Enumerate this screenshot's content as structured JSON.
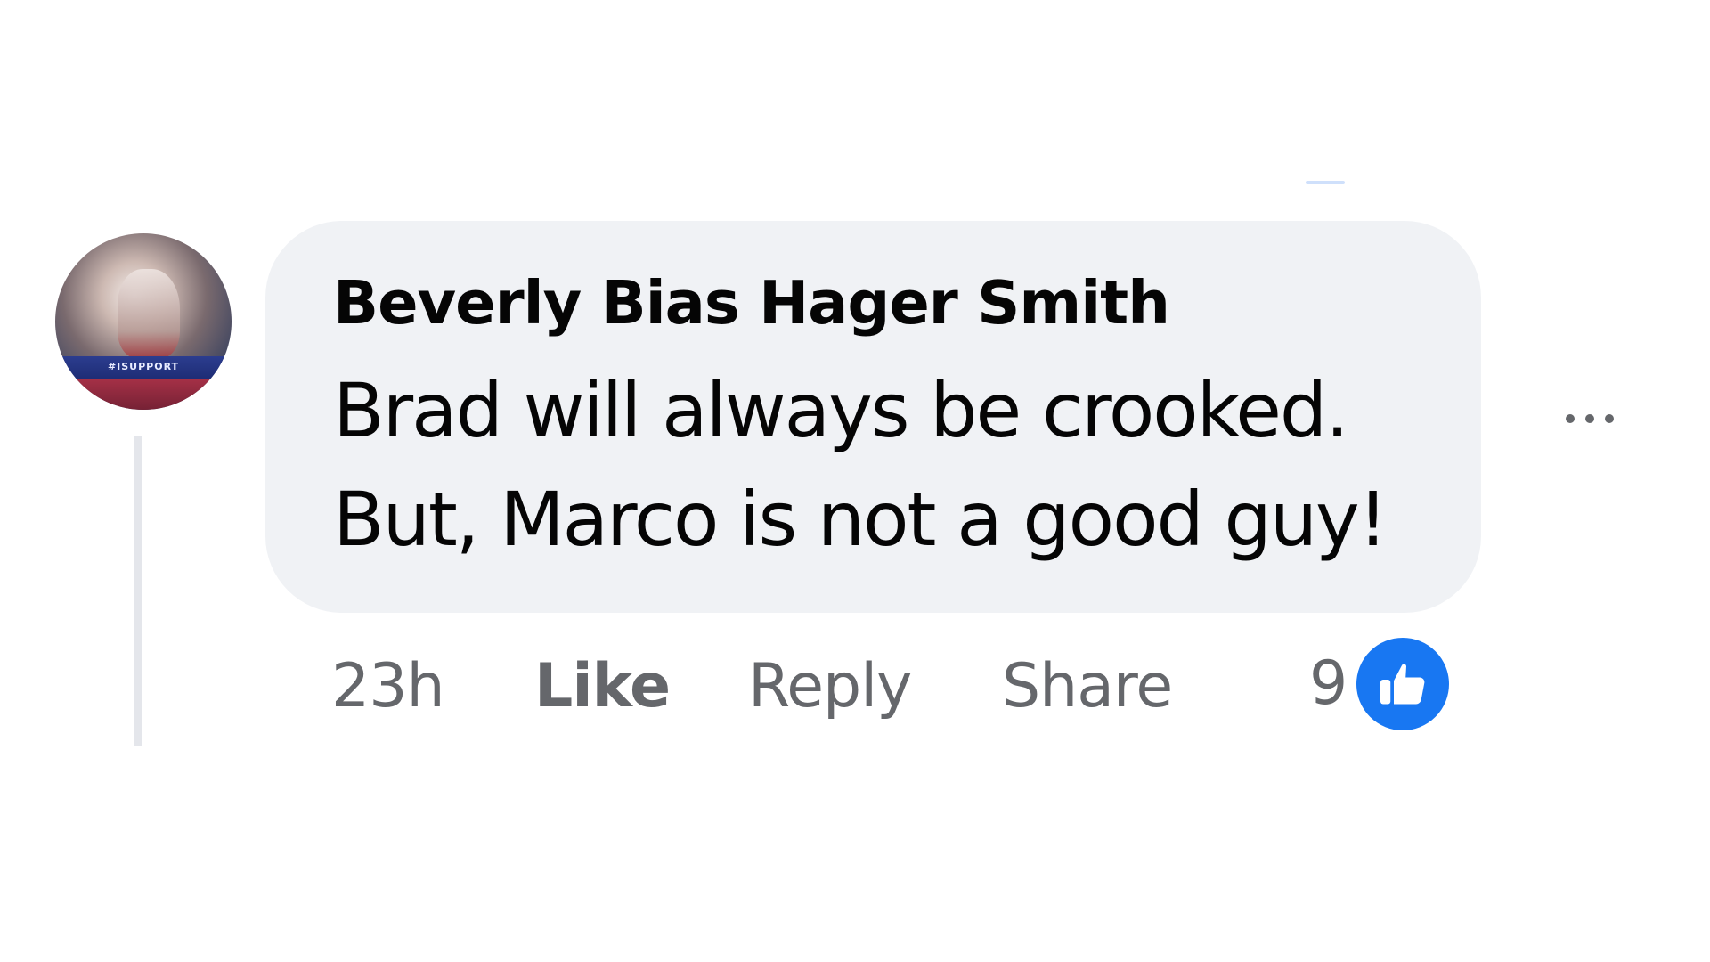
{
  "comment": {
    "author": "Beverly Bias Hager Smith",
    "text_line1": "Brad will always be crooked.",
    "text_line2": "But, Marco is not a good guy!",
    "avatar_banner": "#ISUPPORT"
  },
  "actions": {
    "timestamp": "23h",
    "like_label": "Like",
    "reply_label": "Reply",
    "share_label": "Share"
  },
  "reactions": {
    "count": "9",
    "icon": "thumbs-up-icon"
  },
  "menu": {
    "icon": "more-options-icon"
  },
  "colors": {
    "bubble_bg": "#f0f2f5",
    "text_primary": "#050505",
    "text_secondary": "#65676b",
    "like_blue": "#1877f2",
    "thread_line": "#e4e6eb"
  }
}
